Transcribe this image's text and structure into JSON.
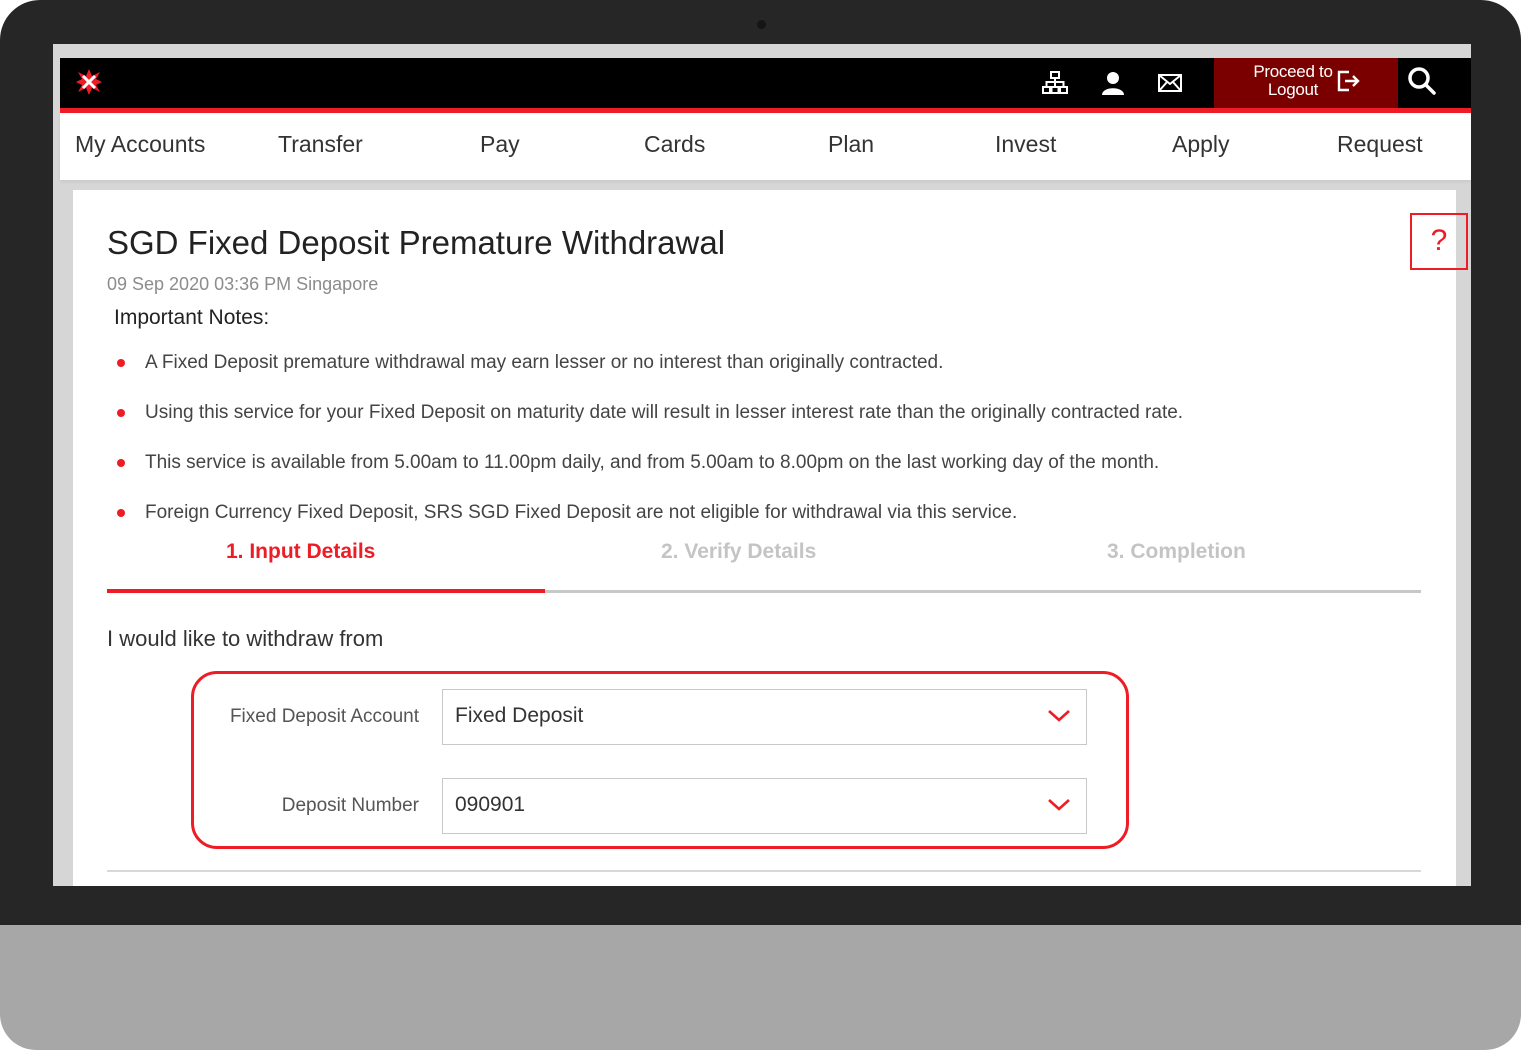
{
  "colors": {
    "brand_red": "#ee1c25",
    "logout_bg": "#7a0000",
    "topbar_bg": "#000000",
    "inactive_step": "#c4c4c4"
  },
  "topbar": {
    "logo_icon": "dbs-star-logo-icon",
    "icons": [
      "sitemap-icon",
      "user-icon",
      "mail-icon"
    ],
    "logout_label": "Proceed to Logout",
    "logout_icon": "logout-arrow-icon",
    "search_icon": "search-icon"
  },
  "nav": {
    "items": [
      "My Accounts",
      "Transfer",
      "Pay",
      "Cards",
      "Plan",
      "Invest",
      "Apply",
      "Request"
    ]
  },
  "page": {
    "title": "SGD Fixed Deposit Premature Withdrawal",
    "timestamp": "09 Sep 2020 03:36 PM Singapore",
    "help_label": "?"
  },
  "notes": {
    "title": "Important Notes:",
    "items": [
      "A Fixed Deposit premature withdrawal may earn lesser or no interest than originally contracted.",
      "Using this service for your Fixed Deposit on maturity date will result in lesser interest rate than the originally contracted rate.",
      "This service is available from 5.00am to 11.00pm daily, and from 5.00am to 8.00pm on the last working day of the month.",
      "Foreign Currency Fixed Deposit, SRS SGD Fixed Deposit are not eligible for withdrawal via this service."
    ]
  },
  "steps": {
    "items": [
      "1. Input Details",
      "2. Verify Details",
      "3. Completion"
    ],
    "active_index": 0
  },
  "form": {
    "intro": "I would like to withdraw from",
    "account_label": "Fixed Deposit Account",
    "account_value": "Fixed Deposit",
    "deposit_label": "Deposit Number",
    "deposit_value": "090901"
  }
}
